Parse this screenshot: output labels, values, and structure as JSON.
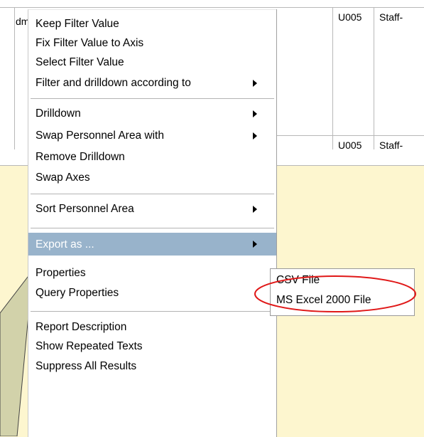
{
  "table": {
    "cell_left": "dm",
    "row1_code": "U005",
    "row1_text": "Staff-",
    "row2_code": "U005",
    "row2_text": "Staff-"
  },
  "menu": {
    "items": [
      {
        "label": "Keep Filter Value",
        "submenu": false
      },
      {
        "label": "Fix Filter Value to Axis",
        "submenu": false
      },
      {
        "label": "Select Filter Value",
        "submenu": false
      },
      {
        "label": "Filter and drilldown according to",
        "submenu": true
      },
      {
        "label": "Drilldown",
        "submenu": true
      },
      {
        "label": "Swap Personnel Area with",
        "submenu": true
      },
      {
        "label": "Remove Drilldown",
        "submenu": false
      },
      {
        "label": "Swap Axes",
        "submenu": false
      },
      {
        "label": "Sort Personnel Area",
        "submenu": true
      },
      {
        "label": "Export as ...",
        "submenu": true,
        "active": true
      },
      {
        "label": "Properties",
        "submenu": false
      },
      {
        "label": "Query Properties",
        "submenu": false
      },
      {
        "label": "Report Description",
        "submenu": false
      },
      {
        "label": "Show Repeated Texts",
        "submenu": false
      },
      {
        "label": "Suppress All Results",
        "submenu": false
      }
    ]
  },
  "submenu": {
    "items": [
      "CSV File",
      "MS Excel 2000 File"
    ],
    "highlighted": "MS Excel 2000 File"
  },
  "colors": {
    "background": "#fdf6cf",
    "menu_active": "#98b3cb",
    "highlight_oval": "#e01818",
    "callout_fill": "#d2d2aa"
  }
}
